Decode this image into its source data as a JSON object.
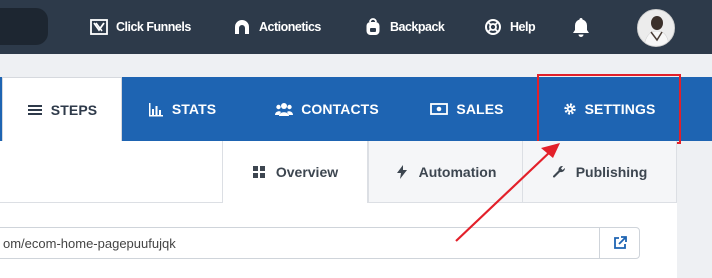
{
  "topnav": {
    "items": [
      {
        "label": "Click Funnels",
        "icon": "clickfunnels-logo-icon"
      },
      {
        "label": "Actionetics",
        "icon": "actionetics-icon"
      },
      {
        "label": "Backpack",
        "icon": "backpack-icon"
      },
      {
        "label": "Help",
        "icon": "lifebuoy-icon"
      }
    ],
    "bell_icon": "bell-icon",
    "avatar_icon": "user-avatar"
  },
  "tabs": [
    {
      "label": "STEPS",
      "icon": "menu-icon"
    },
    {
      "label": "STATS",
      "icon": "bar-chart-icon"
    },
    {
      "label": "CONTACTS",
      "icon": "users-icon"
    },
    {
      "label": "SALES",
      "icon": "money-icon"
    },
    {
      "label": "SETTINGS",
      "icon": "gear-icon"
    }
  ],
  "subtabs": [
    {
      "label": "Overview",
      "icon": "grid-icon"
    },
    {
      "label": "Automation",
      "icon": "bolt-icon"
    },
    {
      "label": "Publishing",
      "icon": "wrench-icon"
    }
  ],
  "url": {
    "value": "om/ecom-home-pagepuufujqk",
    "open_icon": "external-link-icon"
  },
  "colors": {
    "topbar": "#2d3a4a",
    "tabbar": "#1e64b2",
    "highlight": "#e3202a"
  }
}
